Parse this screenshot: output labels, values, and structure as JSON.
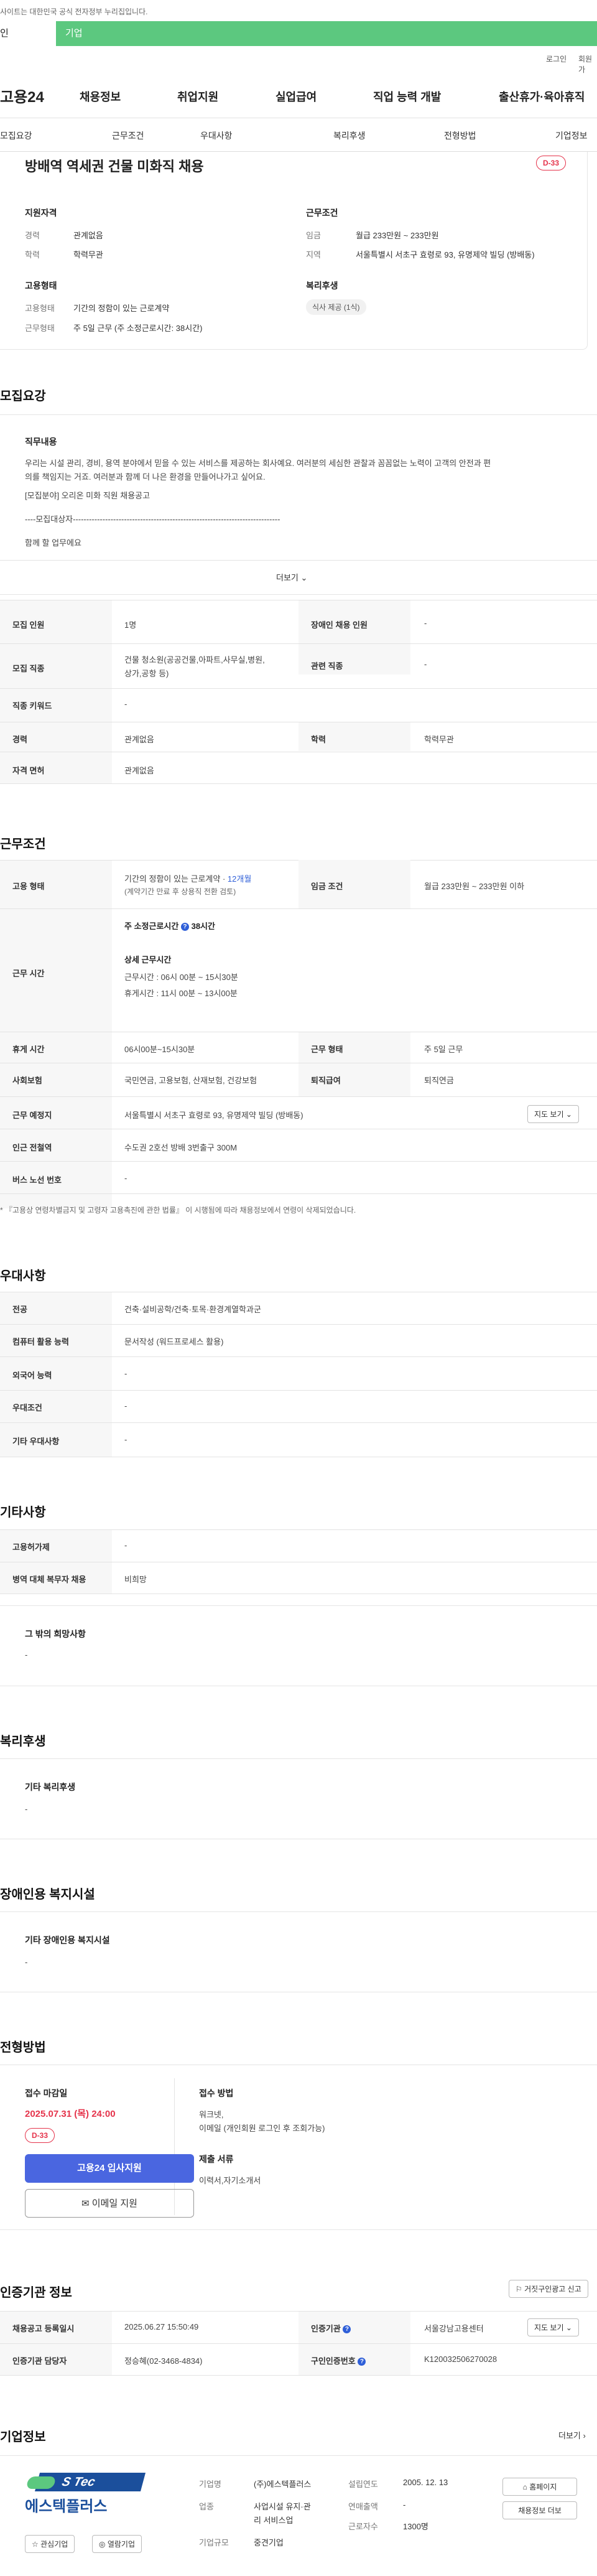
{
  "topbar": {
    "message": "사이트는 대한민국 공식 전자정부 누리집입니다."
  },
  "tabs": {
    "person": "인",
    "corp": "기업"
  },
  "util": {
    "login": "로그인",
    "join": "회원가"
  },
  "gnb": {
    "logo": "고용24",
    "menus": [
      "채용정보",
      "취업지원",
      "실업급여",
      "직업 능력 개발",
      "출산휴가·육아휴직"
    ]
  },
  "snb": [
    "모집요강",
    "근무조건",
    "우대사항",
    "복리후생",
    "전형방법",
    "기업정보"
  ],
  "summary": {
    "title": "방배역 역세권 건물 미화직 채용",
    "dday": "D-33",
    "qual_h": "지원자격",
    "career_k": "경력",
    "career_v": "관계없음",
    "edu_k": "학력",
    "edu_v": "학력무관",
    "emp_h": "고용형태",
    "emptype_k": "고용형태",
    "emptype_v": "기간의 정함이 있는 근로계약",
    "worktype_k": "근무형태",
    "worktype_v": "주 5일 근무 (주 소정근로시간: 38시간)",
    "cond_h": "근무조건",
    "wage_k": "임금",
    "wage_v": "월급 233만원 ~ 233만원",
    "region_k": "지역",
    "region_v": "서울특별시 서초구 효령로 93, 유명제약 빌딩 (방배동)",
    "welfare_h": "복리후생",
    "welfare_chip": "식사 제공 (1식)"
  },
  "recruit": {
    "h": "모집요강",
    "job_h": "직무내용",
    "job_text1": "우리는 시설 관리, 경비, 용역 분야에서 믿을 수 있는 서비스를 제공하는 회사예요. 여러분의 세심한 관찰과 꼼꼼없는 노력이 고객의 안전과 편",
    "job_text2": "의를 책임지는 거죠. 여러분과 함께 더 나은 환경을 만들어나가고 싶어요.",
    "job_text3": "[모집분야] 오리온 미화 직원 채용공고",
    "job_text4": "----모집대상자-----------------------------------------------------------------------------",
    "job_text5": "함께 할 업무에요",
    "more": "더보기",
    "rows": [
      {
        "k1": "모집 인원",
        "v1": "1명",
        "k2": "장애인 채용 인원",
        "v2": "-"
      },
      {
        "k1": "모집 직종",
        "v1a": "건물 청소원(공공건물,아파트,사무실,병원,",
        "v1b": "상가,공항 등)",
        "k2": "관련 직종",
        "v2": "-"
      },
      {
        "k1": "직종 키워드",
        "v1": "-"
      },
      {
        "k1": "경력",
        "v1": "관계없음",
        "k2": "학력",
        "v2": "학력무관"
      },
      {
        "k1": "자격 면허",
        "v1": "관계없음"
      }
    ]
  },
  "conditions": {
    "h": "근무조건",
    "emp_k": "고용 형태",
    "emp_v1": "기간의 정함이 있는 근로계약 · ",
    "emp_v1b": "12개월",
    "emp_v2": "(계약기간 만료 후 상용직 전환 검토)",
    "wage_k": "임금 조건",
    "wage_v": "월급 233만원 ~ 233만원 이하",
    "time_k": "근무 시간",
    "time_weekly": "주 소정근로시간",
    "time_weekly_v": "38시간",
    "time_detail_h": "상세 근무시간",
    "time_detail1": "근무시간 : 06시 00분 ~ 15시30분",
    "time_detail2": "휴게시간 : 11시 00분 ~ 13시00분",
    "rest_k": "휴게 시간",
    "rest_v": "06시00분~15시30분",
    "form_k": "근무 형태",
    "form_v": "주 5일 근무",
    "ins_k": "사회보험",
    "ins_v": "국민연금, 고용보험, 산재보험, 건강보험",
    "retire_k": "퇴직급여",
    "retire_v": "퇴직연금",
    "place_k": "근무 예정지",
    "place_v": "서울특별시 서초구 효령로 93, 유명제약 빌딩 (방배동)",
    "map_btn": "지도 보기",
    "station_k": "인근 전철역",
    "station_v": "수도권 2호선 방배 3번출구 300M",
    "bus_k": "버스 노선 번호",
    "bus_v": "-",
    "note": "* 『고용상 연령차별금지 및 고령자 고용촉진에 관한 법률』 이 시행됨에 따라 채용정보에서 연령이 삭제되었습니다."
  },
  "pref": {
    "h": "우대사항",
    "rows": [
      {
        "k": "전공",
        "v": "건축·설비공학/건축·토목·환경계열학과군"
      },
      {
        "k": "컴퓨터 활용 능력",
        "v": "문서작성 (워드프로세스 활용)"
      },
      {
        "k": "외국어 능력",
        "v": "-"
      },
      {
        "k": "우대조건",
        "v": "-"
      },
      {
        "k": "기타 우대사항",
        "v": "-"
      }
    ]
  },
  "etc": {
    "h": "기타사항",
    "rows": [
      {
        "k": "고용허가제",
        "v": "-"
      },
      {
        "k": "병역 대체 복무자 채용",
        "v": "비희망"
      }
    ],
    "other_h": "그 밖의 희망사항",
    "other_v": "-"
  },
  "welfare": {
    "h": "복리후생",
    "sub": "기타 복리후생",
    "v": "-"
  },
  "disabled": {
    "h": "장애인용 복지시설",
    "sub": "기타 장애인용 복지시설",
    "v": "-"
  },
  "process": {
    "h": "전형방법",
    "deadline_h": "접수 마감일",
    "deadline": "2025.07.31 (목) 24:00",
    "dday": "D-33",
    "apply_btn": "고용24 입사지원",
    "email_btn": "이메일 지원",
    "method_h": "접수 방법",
    "method_v1": "워크넷,",
    "method_v2": "이메일 (개인회원 로그인 후 조회가능)",
    "docs_h": "제출 서류",
    "docs_v": "이력서,자기소개서"
  },
  "agency": {
    "h": "인증기관 정보",
    "report_btn": "거짓구인광고 신고",
    "reg_k": "채용공고 등록일시",
    "reg_v": "2025.06.27 15:50:49",
    "org_k": "인증기관",
    "org_v": "서울강남고용센터",
    "map_btn": "지도 보기",
    "mgr_k": "인증기관 담당자",
    "mgr_v": "정승혜(02-3468-4834)",
    "num_k": "구인인증번호",
    "num_v": "K120032506270028"
  },
  "company": {
    "h": "기업정보",
    "more": "더보기",
    "logo_top": "S Tec",
    "logo_name": "에스텍플러스",
    "fav_btn": "관심기업",
    "follow_btn": "열람기업",
    "name_k": "기업명",
    "name_v": "(주)에스텍플러스",
    "industry_k": "업종",
    "industry_v1": "사업시설 유지·관",
    "industry_v2": "리 서비스업",
    "size_k": "기업규모",
    "size_v": "중견기업",
    "found_k": "설립연도",
    "found_v": "2005. 12. 13",
    "sales_k": "연매출액",
    "sales_v": "-",
    "emp_k": "근로자수",
    "emp_v": "1300명",
    "home_btn": "홈페이지",
    "list_btn": "채용정보 더보"
  }
}
